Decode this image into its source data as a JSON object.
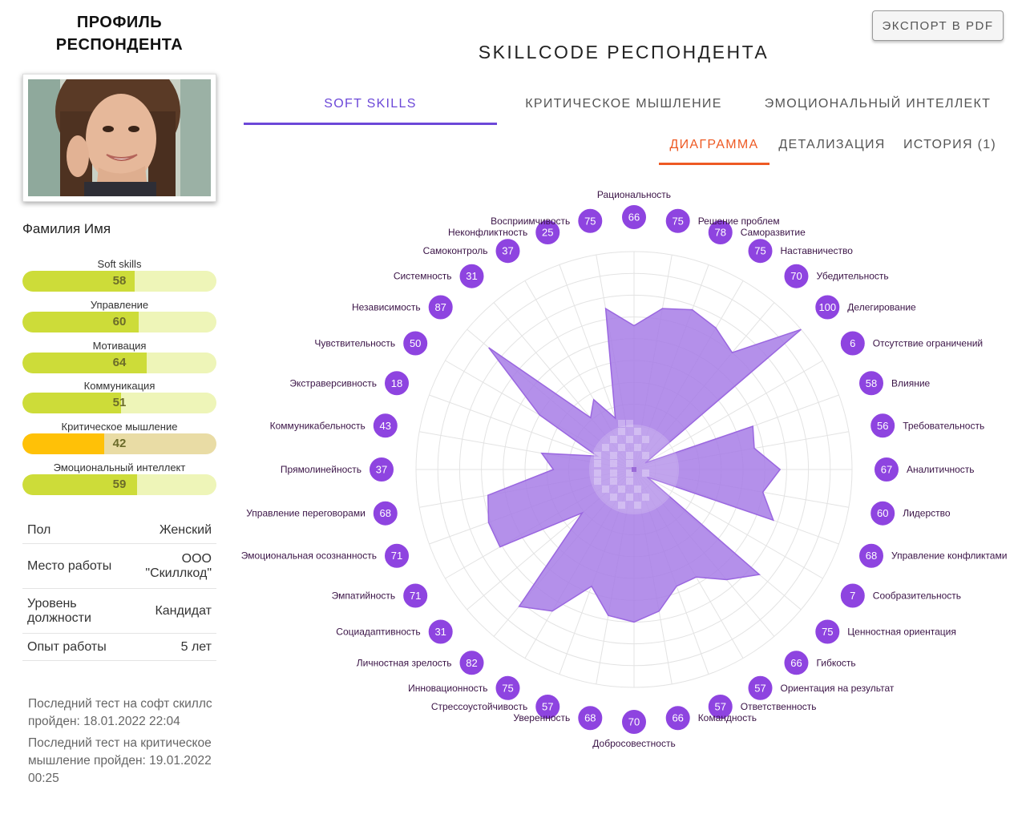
{
  "sidebar": {
    "title_line1": "ПРОФИЛЬ",
    "title_line2": "РЕСПОНДЕНТА",
    "name": "Фамилия Имя",
    "metrics": [
      {
        "label": "Soft skills",
        "value": 58,
        "color": "#cddc39",
        "track": "#eef5b8"
      },
      {
        "label": "Управление",
        "value": 60,
        "color": "#cddc39",
        "track": "#eef5b8"
      },
      {
        "label": "Мотивация",
        "value": 64,
        "color": "#cddc39",
        "track": "#eef5b8"
      },
      {
        "label": "Коммуникация",
        "value": 51,
        "color": "#cddc39",
        "track": "#eef5b8"
      },
      {
        "label": "Критическое мышление",
        "value": 42,
        "color": "#ffc107",
        "track": "#e9dca5"
      },
      {
        "label": "Эмоциональный интеллект",
        "value": 59,
        "color": "#cddc39",
        "track": "#eef5b8"
      }
    ],
    "info": [
      {
        "key": "Пол",
        "value": "Женский"
      },
      {
        "key": "Место работы",
        "value": "ООО \"Скиллкод\""
      },
      {
        "key": "Уровень должности",
        "value": "Кандидат"
      },
      {
        "key": "Опыт работы",
        "value": "5 лет"
      }
    ],
    "note1": "Последний тест на софт скиллс пройден: 18.01.2022 22:04",
    "note2": "Последний тест на критическое мышление пройден: 19.01.2022 00:25"
  },
  "header": {
    "export_label": "ЭКСПОРТ В PDF",
    "title": "SKILLCODE РЕСПОНДЕНТА"
  },
  "tabs": [
    {
      "label": "SOFT SKILLS",
      "active": true
    },
    {
      "label": "КРИТИЧЕСКОЕ МЫШЛЕНИЕ",
      "active": false
    },
    {
      "label": "ЭМОЦИОНАЛЬНЫЙ ИНТЕЛЛЕКТ",
      "active": false
    }
  ],
  "sub_tabs": [
    {
      "label": "ДИАГРАММА",
      "active": true
    },
    {
      "label": "ДЕТАЛИЗАЦИЯ",
      "active": false
    },
    {
      "label": "ИСТОРИЯ (1)",
      "active": false
    }
  ],
  "chart_data": {
    "type": "radar",
    "rmax": 100,
    "fill_color": "#a77de6",
    "badge_color": "#8e44e0",
    "axes": [
      {
        "label": "Рациональность",
        "value": 66
      },
      {
        "label": "Решение проблем",
        "value": 75
      },
      {
        "label": "Саморазвитие",
        "value": 78
      },
      {
        "label": "Наставничество",
        "value": 75
      },
      {
        "label": "Убедительность",
        "value": 70
      },
      {
        "label": "Делегирование",
        "value": 100
      },
      {
        "label": "Отсутствие ограничений",
        "value": 6
      },
      {
        "label": "Влияние",
        "value": 58
      },
      {
        "label": "Требовательность",
        "value": 56
      },
      {
        "label": "Аналитичность",
        "value": 67
      },
      {
        "label": "Лидерство",
        "value": 60
      },
      {
        "label": "Управление конфликтами",
        "value": 68
      },
      {
        "label": "Сообразительность",
        "value": 7
      },
      {
        "label": "Ценностная ориентация",
        "value": 75
      },
      {
        "label": "Гибкость",
        "value": 66
      },
      {
        "label": "Ориентация на результат",
        "value": 57
      },
      {
        "label": "Ответственность",
        "value": 57
      },
      {
        "label": "Командность",
        "value": 66
      },
      {
        "label": "Добросовестность",
        "value": 70
      },
      {
        "label": "Уверенность",
        "value": 68
      },
      {
        "label": "Стрессоустойчивость",
        "value": 57
      },
      {
        "label": "Инновационность",
        "value": 75
      },
      {
        "label": "Личностная зрелость",
        "value": 82
      },
      {
        "label": "Социадаптивность",
        "value": 31
      },
      {
        "label": "Эмпатийность",
        "value": 71
      },
      {
        "label": "Эмоциональная осознанность",
        "value": 71
      },
      {
        "label": "Управление переговорами",
        "value": 68
      },
      {
        "label": "Прямолинейность",
        "value": 37
      },
      {
        "label": "Коммуникабельность",
        "value": 43
      },
      {
        "label": "Экстраверсивность",
        "value": 18
      },
      {
        "label": "Чувствительность",
        "value": 50
      },
      {
        "label": "Независимость",
        "value": 87
      },
      {
        "label": "Системность",
        "value": 31
      },
      {
        "label": "Самоконтроль",
        "value": 37
      },
      {
        "label": "Неконфликтность",
        "value": 25
      },
      {
        "label": "Восприимчивость",
        "value": 75
      }
    ]
  }
}
